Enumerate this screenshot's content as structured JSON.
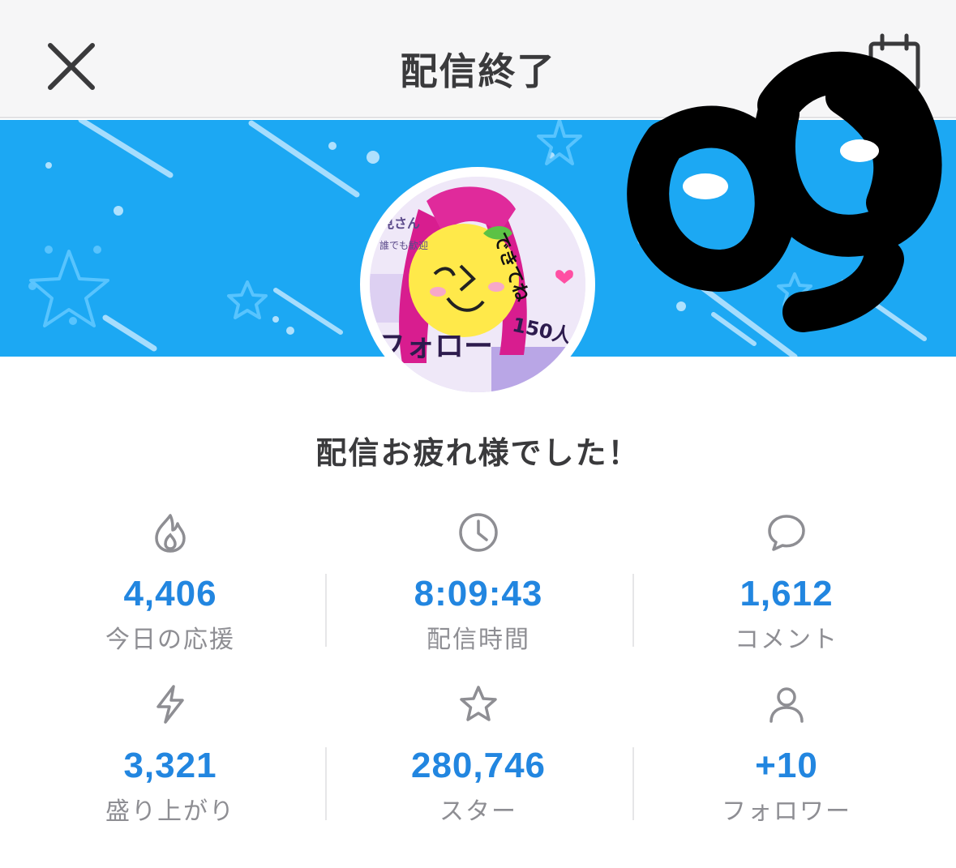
{
  "header": {
    "title": "配信終了",
    "close_icon": "close-icon",
    "calendar_icon": "calendar-icon"
  },
  "avatar": {
    "image_text": {
      "follow": "フォロー",
      "count": "150人",
      "message": "できてね",
      "name_fragment": "見さん",
      "tag_fragment": "誰でも歓迎"
    }
  },
  "congrats_message": "配信お疲れ様でした！",
  "stats": [
    {
      "icon": "flame-icon",
      "value": "4,406",
      "label": "今日の応援"
    },
    {
      "icon": "clock-icon",
      "value": "8:09:43",
      "label": "配信時間"
    },
    {
      "icon": "comment-icon",
      "value": "1,612",
      "label": "コメント"
    },
    {
      "icon": "lightning-icon",
      "value": "3,321",
      "label": "盛り上がり"
    },
    {
      "icon": "star-icon",
      "value": "280,746",
      "label": "スター"
    },
    {
      "icon": "person-icon",
      "value": "+10",
      "label": "フォロワー"
    }
  ],
  "colors": {
    "banner": "#1ca8f3",
    "value": "#2286e0",
    "label": "#8e8e93",
    "title": "#3a3a3c"
  }
}
